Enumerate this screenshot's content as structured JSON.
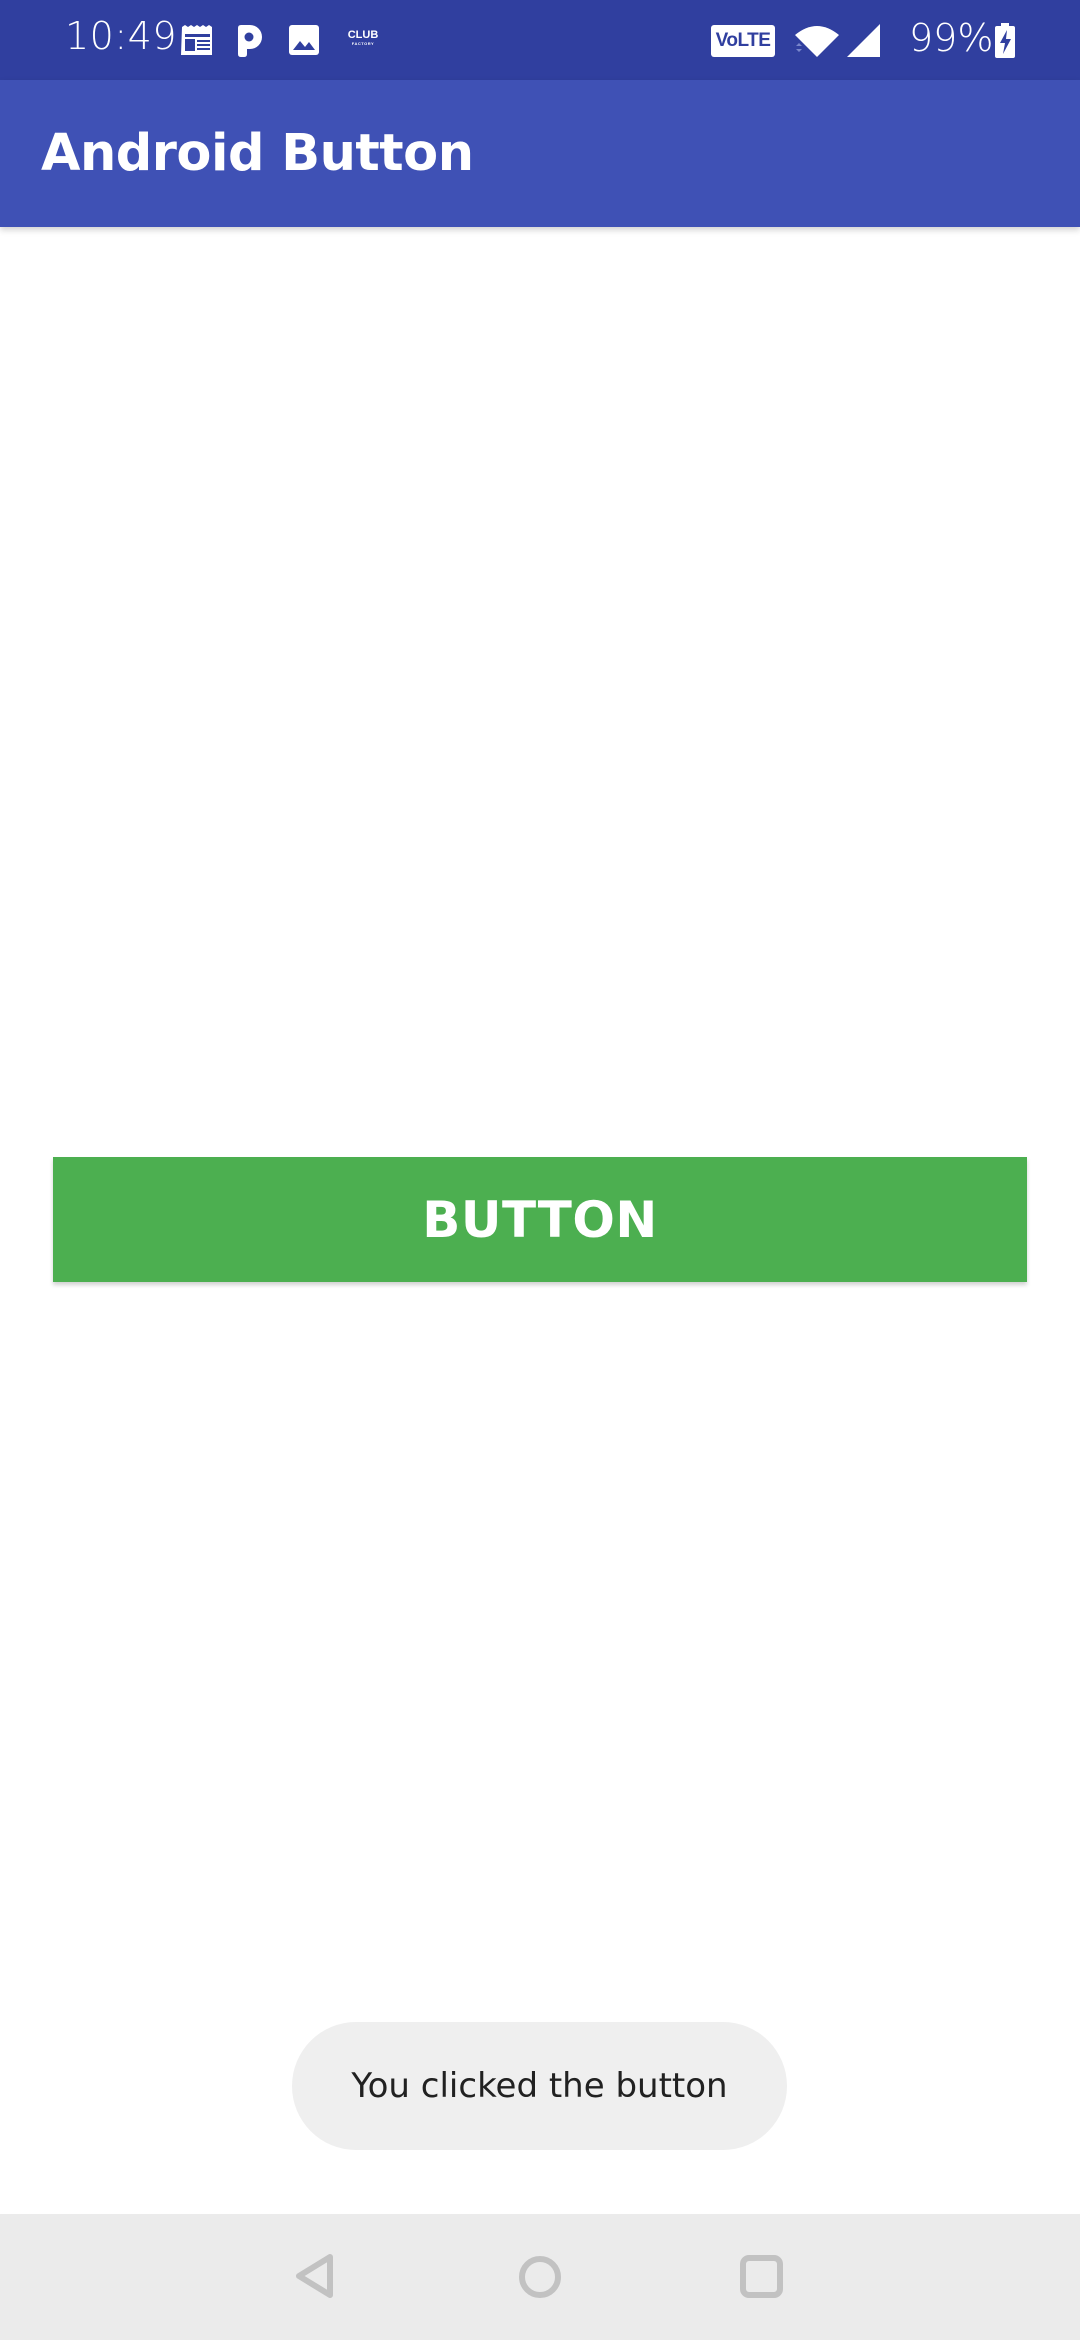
{
  "status_bar": {
    "time": "10:49",
    "notification_icons": [
      "news-icon",
      "p-app-icon",
      "gallery-icon",
      "club-factory-icon"
    ],
    "club_factory_logo": {
      "top": "CLUB",
      "bottom": "FACTORY"
    },
    "volte_label": "VoLTE",
    "battery_percent": "99%",
    "colors": {
      "background": "#303f9f",
      "foreground": "#ffffff"
    }
  },
  "app_bar": {
    "title": "Android Button",
    "color": "#3f51b5"
  },
  "main": {
    "button_label": "BUTTON",
    "button_color": "#4caf50"
  },
  "toast": {
    "message": "You clicked the button"
  },
  "nav_bar": {
    "buttons": [
      "back",
      "home",
      "recents"
    ]
  }
}
